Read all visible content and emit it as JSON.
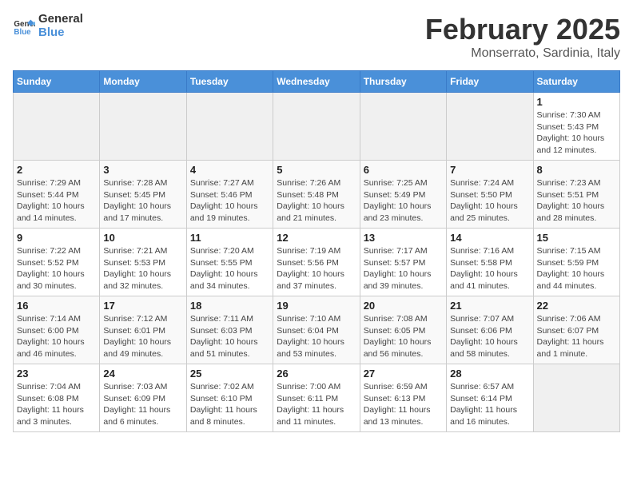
{
  "logo": {
    "text_general": "General",
    "text_blue": "Blue"
  },
  "header": {
    "month": "February 2025",
    "location": "Monserrato, Sardinia, Italy"
  },
  "weekdays": [
    "Sunday",
    "Monday",
    "Tuesday",
    "Wednesday",
    "Thursday",
    "Friday",
    "Saturday"
  ],
  "weeks": [
    [
      {
        "day": "",
        "info": ""
      },
      {
        "day": "",
        "info": ""
      },
      {
        "day": "",
        "info": ""
      },
      {
        "day": "",
        "info": ""
      },
      {
        "day": "",
        "info": ""
      },
      {
        "day": "",
        "info": ""
      },
      {
        "day": "1",
        "info": "Sunrise: 7:30 AM\nSunset: 5:43 PM\nDaylight: 10 hours\nand 12 minutes."
      }
    ],
    [
      {
        "day": "2",
        "info": "Sunrise: 7:29 AM\nSunset: 5:44 PM\nDaylight: 10 hours\nand 14 minutes."
      },
      {
        "day": "3",
        "info": "Sunrise: 7:28 AM\nSunset: 5:45 PM\nDaylight: 10 hours\nand 17 minutes."
      },
      {
        "day": "4",
        "info": "Sunrise: 7:27 AM\nSunset: 5:46 PM\nDaylight: 10 hours\nand 19 minutes."
      },
      {
        "day": "5",
        "info": "Sunrise: 7:26 AM\nSunset: 5:48 PM\nDaylight: 10 hours\nand 21 minutes."
      },
      {
        "day": "6",
        "info": "Sunrise: 7:25 AM\nSunset: 5:49 PM\nDaylight: 10 hours\nand 23 minutes."
      },
      {
        "day": "7",
        "info": "Sunrise: 7:24 AM\nSunset: 5:50 PM\nDaylight: 10 hours\nand 25 minutes."
      },
      {
        "day": "8",
        "info": "Sunrise: 7:23 AM\nSunset: 5:51 PM\nDaylight: 10 hours\nand 28 minutes."
      }
    ],
    [
      {
        "day": "9",
        "info": "Sunrise: 7:22 AM\nSunset: 5:52 PM\nDaylight: 10 hours\nand 30 minutes."
      },
      {
        "day": "10",
        "info": "Sunrise: 7:21 AM\nSunset: 5:53 PM\nDaylight: 10 hours\nand 32 minutes."
      },
      {
        "day": "11",
        "info": "Sunrise: 7:20 AM\nSunset: 5:55 PM\nDaylight: 10 hours\nand 34 minutes."
      },
      {
        "day": "12",
        "info": "Sunrise: 7:19 AM\nSunset: 5:56 PM\nDaylight: 10 hours\nand 37 minutes."
      },
      {
        "day": "13",
        "info": "Sunrise: 7:17 AM\nSunset: 5:57 PM\nDaylight: 10 hours\nand 39 minutes."
      },
      {
        "day": "14",
        "info": "Sunrise: 7:16 AM\nSunset: 5:58 PM\nDaylight: 10 hours\nand 41 minutes."
      },
      {
        "day": "15",
        "info": "Sunrise: 7:15 AM\nSunset: 5:59 PM\nDaylight: 10 hours\nand 44 minutes."
      }
    ],
    [
      {
        "day": "16",
        "info": "Sunrise: 7:14 AM\nSunset: 6:00 PM\nDaylight: 10 hours\nand 46 minutes."
      },
      {
        "day": "17",
        "info": "Sunrise: 7:12 AM\nSunset: 6:01 PM\nDaylight: 10 hours\nand 49 minutes."
      },
      {
        "day": "18",
        "info": "Sunrise: 7:11 AM\nSunset: 6:03 PM\nDaylight: 10 hours\nand 51 minutes."
      },
      {
        "day": "19",
        "info": "Sunrise: 7:10 AM\nSunset: 6:04 PM\nDaylight: 10 hours\nand 53 minutes."
      },
      {
        "day": "20",
        "info": "Sunrise: 7:08 AM\nSunset: 6:05 PM\nDaylight: 10 hours\nand 56 minutes."
      },
      {
        "day": "21",
        "info": "Sunrise: 7:07 AM\nSunset: 6:06 PM\nDaylight: 10 hours\nand 58 minutes."
      },
      {
        "day": "22",
        "info": "Sunrise: 7:06 AM\nSunset: 6:07 PM\nDaylight: 11 hours\nand 1 minute."
      }
    ],
    [
      {
        "day": "23",
        "info": "Sunrise: 7:04 AM\nSunset: 6:08 PM\nDaylight: 11 hours\nand 3 minutes."
      },
      {
        "day": "24",
        "info": "Sunrise: 7:03 AM\nSunset: 6:09 PM\nDaylight: 11 hours\nand 6 minutes."
      },
      {
        "day": "25",
        "info": "Sunrise: 7:02 AM\nSunset: 6:10 PM\nDaylight: 11 hours\nand 8 minutes."
      },
      {
        "day": "26",
        "info": "Sunrise: 7:00 AM\nSunset: 6:11 PM\nDaylight: 11 hours\nand 11 minutes."
      },
      {
        "day": "27",
        "info": "Sunrise: 6:59 AM\nSunset: 6:13 PM\nDaylight: 11 hours\nand 13 minutes."
      },
      {
        "day": "28",
        "info": "Sunrise: 6:57 AM\nSunset: 6:14 PM\nDaylight: 11 hours\nand 16 minutes."
      },
      {
        "day": "",
        "info": ""
      }
    ]
  ]
}
